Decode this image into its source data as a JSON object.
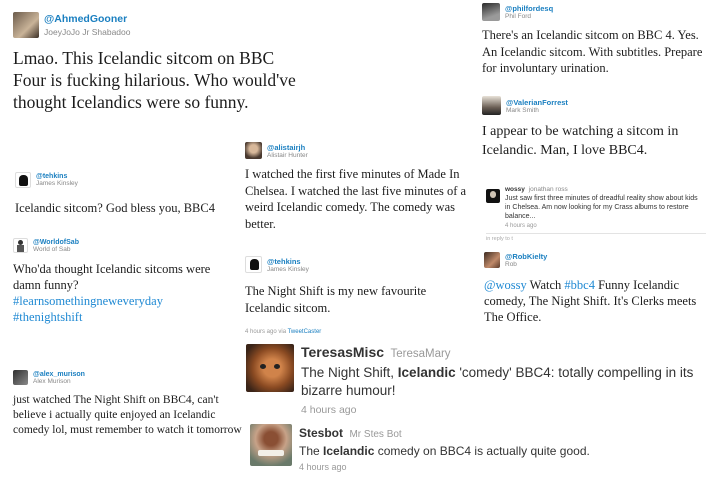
{
  "tweets": {
    "ahmed": {
      "handle": "@AhmedGooner",
      "name": "JoeyJoJo Jr Shabadoo",
      "text": "Lmao. This Icelandic sitcom on BBC Four is fucking hilarious. Who would've thought Icelandics were so funny."
    },
    "philfordesq": {
      "handle": "@philfordesq",
      "name": "Phil Ford",
      "text": "There's an Icelandic sitcom on BBC 4. Yes. An Icelandic sitcom. With subtitles. Prepare for involuntary urination."
    },
    "valerian": {
      "handle": "@ValerianForrest",
      "name": "Mark Smith",
      "text": "I appear to be watching a sitcom in Icelandic. Man, I love BBC4."
    },
    "alistair": {
      "handle": "@alistairjh",
      "name": "Alistair Hunter",
      "text": "I watched the first five minutes of Made In Chelsea. I watched the last five minutes of a weird Icelandic comedy. The comedy was better."
    },
    "tehkins1": {
      "handle": "@tehkins",
      "name": "James Kinsley",
      "text": "Icelandic sitcom? God bless you, BBC4"
    },
    "wossy": {
      "handle": "wossy",
      "name": "jonathan ross",
      "text": "Just saw first three minutes of dreadful reality show about kids in Chelsea. Am now looking for my Crass albums to restore balance...",
      "time": "4 hours ago",
      "reply": "in reply to t"
    },
    "worldofsab": {
      "handle": "@WorldofSab",
      "name": "World of Sab",
      "text": "Who'da thought Icelandic sitcoms were damn funny?",
      "tag1": "#learnsomethingneweveryday",
      "tag2": "#thenightshift"
    },
    "tehkins2": {
      "handle": "@tehkins",
      "name": "James Kinsley",
      "text": "The Night Shift is my new favourite Icelandic sitcom.",
      "meta": "4 hours ago via",
      "via": "TweetCaster"
    },
    "robkielty": {
      "handle": "@RobKielty",
      "name": "Rob",
      "mention": "@wossy",
      "w1": " Watch ",
      "tag": "#bbc4",
      "rest": " Funny Icelandic comedy, The Night Shift. It's Clerks meets The Office."
    },
    "alexmurison": {
      "handle": "@alex_murison",
      "name": "Alex Murison",
      "text": "just watched The Night Shift on BBC4, can't believe i actually quite enjoyed an Icelandic comedy lol, must remember to watch it tomorrow"
    },
    "teresas": {
      "handle": "TeresasMisc",
      "name": "TeresaMary",
      "p1": "The Night Shift, ",
      "bold": "Icelandic",
      "p2": " 'comedy' BBC4: totally compelling in its bizarre humour!",
      "time": "4 hours ago"
    },
    "stesbot": {
      "handle": "Stesbot",
      "name": "Mr Stes Bot",
      "p1": "The ",
      "bold": "Icelandic",
      "p2": " comedy on BBC4 is actually quite good.",
      "time": "4 hours ago"
    }
  }
}
